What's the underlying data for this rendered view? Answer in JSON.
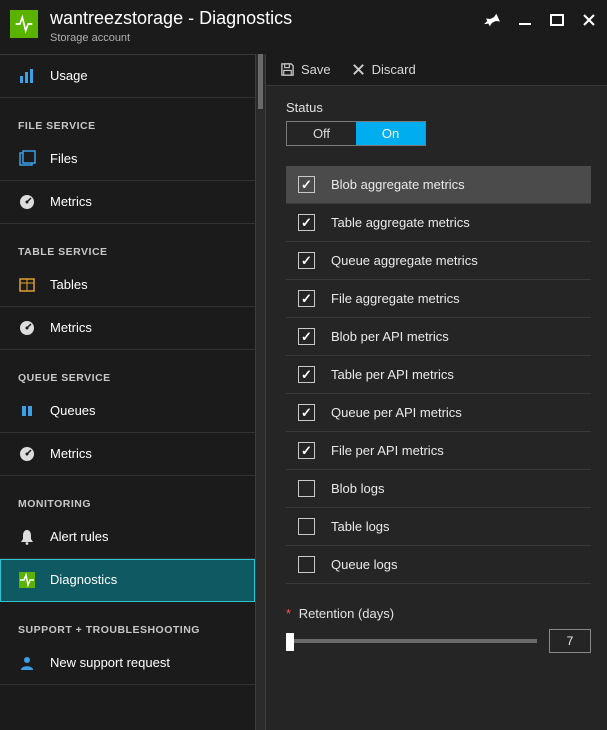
{
  "header": {
    "title": "wantreezstorage - Diagnostics",
    "subtitle": "Storage account"
  },
  "commands": {
    "save": "Save",
    "discard": "Discard"
  },
  "sidebar": {
    "top": {
      "usage": "Usage"
    },
    "sections": {
      "file": {
        "label": "FILE SERVICE",
        "files": "Files",
        "metrics": "Metrics"
      },
      "table": {
        "label": "TABLE SERVICE",
        "tables": "Tables",
        "metrics": "Metrics"
      },
      "queue": {
        "label": "QUEUE SERVICE",
        "queues": "Queues",
        "metrics": "Metrics"
      },
      "monitoring": {
        "label": "MONITORING",
        "alertrules": "Alert rules",
        "diagnostics": "Diagnostics"
      },
      "support": {
        "label": "SUPPORT + TROUBLESHOOTING",
        "newrequest": "New support request"
      }
    }
  },
  "status": {
    "label": "Status",
    "off": "Off",
    "on": "On",
    "value": "On"
  },
  "metrics": [
    {
      "label": "Blob aggregate metrics",
      "checked": true,
      "highlight": true
    },
    {
      "label": "Table aggregate metrics",
      "checked": true,
      "highlight": false
    },
    {
      "label": "Queue aggregate metrics",
      "checked": true,
      "highlight": false
    },
    {
      "label": "File aggregate metrics",
      "checked": true,
      "highlight": false
    },
    {
      "label": "Blob per API metrics",
      "checked": true,
      "highlight": false
    },
    {
      "label": "Table per API metrics",
      "checked": true,
      "highlight": false
    },
    {
      "label": "Queue per API metrics",
      "checked": true,
      "highlight": false
    },
    {
      "label": "File per API metrics",
      "checked": true,
      "highlight": false
    },
    {
      "label": "Blob logs",
      "checked": false,
      "highlight": false
    },
    {
      "label": "Table logs",
      "checked": false,
      "highlight": false
    },
    {
      "label": "Queue logs",
      "checked": false,
      "highlight": false
    }
  ],
  "retention": {
    "label": "Retention (days)",
    "value": "7"
  }
}
